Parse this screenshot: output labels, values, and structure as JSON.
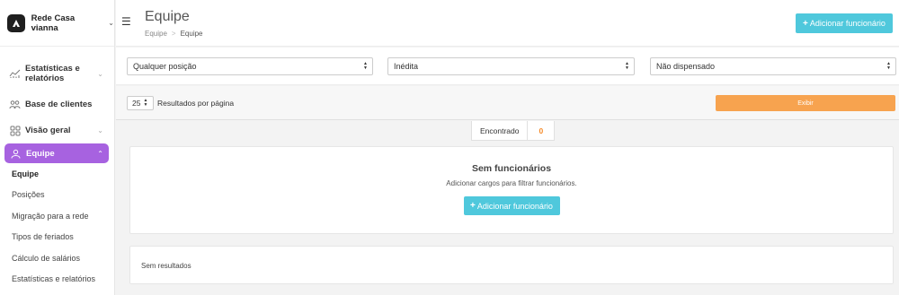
{
  "brand": {
    "name": "Rede Casa vianna"
  },
  "sidebar": {
    "items": [
      {
        "label": "Estatísticas e relatórios",
        "icon": "chart-icon",
        "has_chevron": true
      },
      {
        "label": "Base de clientes",
        "icon": "users-icon",
        "has_chevron": false
      },
      {
        "label": "Visão geral",
        "icon": "grid-icon",
        "has_chevron": true
      },
      {
        "label": "Equipe",
        "icon": "person-icon",
        "has_chevron": true,
        "active": true
      }
    ],
    "subitems": [
      {
        "label": "Equipe",
        "current": true
      },
      {
        "label": "Posições"
      },
      {
        "label": "Migração para a rede"
      },
      {
        "label": "Tipos de feriados"
      },
      {
        "label": "Cálculo de salários"
      },
      {
        "label": "Estatísticas e relatórios"
      }
    ]
  },
  "header": {
    "title": "Equipe",
    "breadcrumb": {
      "parent": "Equipe",
      "separator": ">",
      "current": "Equipe"
    },
    "add_button": "Adicionar funcionário"
  },
  "filters": {
    "position": "Qualquer posição",
    "status": "Inédita",
    "dismissal": "Não dispensado"
  },
  "results": {
    "per_page_value": "25",
    "per_page_label": "Resultados por página",
    "show_button": "Exibir"
  },
  "found": {
    "label": "Encontrado",
    "count": "0"
  },
  "empty_state": {
    "title": "Sem funcionários",
    "subtitle": "Adicionar cargos para filtrar funcionários.",
    "button": "Adicionar funcionário"
  },
  "no_results": {
    "text": "Sem resultados"
  },
  "colors": {
    "accent_purple": "#a762e0",
    "accent_cyan": "#4fc8dc",
    "accent_orange": "#f7a34f",
    "count_orange": "#f58a28"
  }
}
